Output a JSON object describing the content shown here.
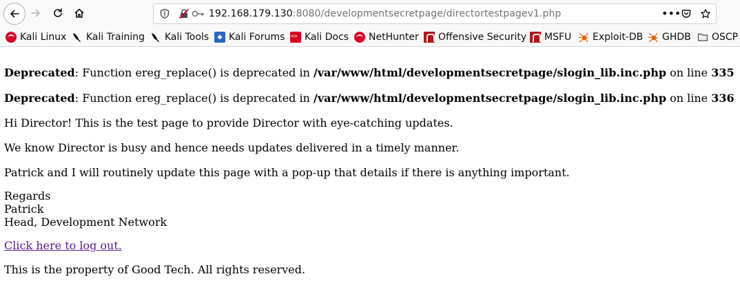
{
  "browser": {
    "url_host": "192.168.179.130",
    "url_rest": ":8080/developmentsecretpage/directortestpagev1.php",
    "more_label": "•••",
    "icons": [
      "back-icon",
      "forward-icon",
      "reload-icon",
      "home-icon",
      "tracking-shield-icon",
      "insecure-lock-icon",
      "key-icon",
      "page-actions-icon",
      "pocket-icon",
      "bookmark-star-icon"
    ]
  },
  "bookmarks": [
    {
      "label": "Kali Linux",
      "icon": "kali-icon"
    },
    {
      "label": "Kali Training",
      "icon": "kali-dragon-icon"
    },
    {
      "label": "Kali Tools",
      "icon": "kali-dragon-icon"
    },
    {
      "label": "Kali Forums",
      "icon": "kali-forums-icon"
    },
    {
      "label": "Kali Docs",
      "icon": "kali-docs-icon"
    },
    {
      "label": "NetHunter",
      "icon": "kali-icon"
    },
    {
      "label": "Offensive Security",
      "icon": "offsec-icon"
    },
    {
      "label": "MSFU",
      "icon": "offsec-icon"
    },
    {
      "label": "Exploit-DB",
      "icon": "spider-icon"
    },
    {
      "label": "GHDB",
      "icon": "spider-icon"
    },
    {
      "label": "OSCP",
      "icon": "folder-icon"
    }
  ],
  "page": {
    "warnings": [
      {
        "level": "Deprecated",
        "message": ": Function ereg_replace() is deprecated in ",
        "path": "/var/www/html/developmentsecretpage/slogin_lib.inc.php",
        "on_line": " on line ",
        "line": "335"
      },
      {
        "level": "Deprecated",
        "message": ": Function ereg_replace() is deprecated in ",
        "path": "/var/www/html/developmentsecretpage/slogin_lib.inc.php",
        "on_line": " on line ",
        "line": "336"
      }
    ],
    "paragraphs": [
      "Hi Director! This is the test page to provide Director with eye-catching updates.",
      "We know Director is busy and hence needs updates delivered in a timely manner.",
      "Patrick and I will routinely update this page with a pop-up that details if there is anything important."
    ],
    "signature": [
      "Regards",
      "Patrick",
      "Head, Development Network"
    ],
    "logout_link": "Click here to log out.",
    "footer": "This is the property of Good Tech. All rights reserved."
  },
  "colors": {
    "link_visited": "#551a8b",
    "toolbar_bg": "#f9f9fa",
    "url_dim": "#737373",
    "kali_red": "#d70022"
  }
}
